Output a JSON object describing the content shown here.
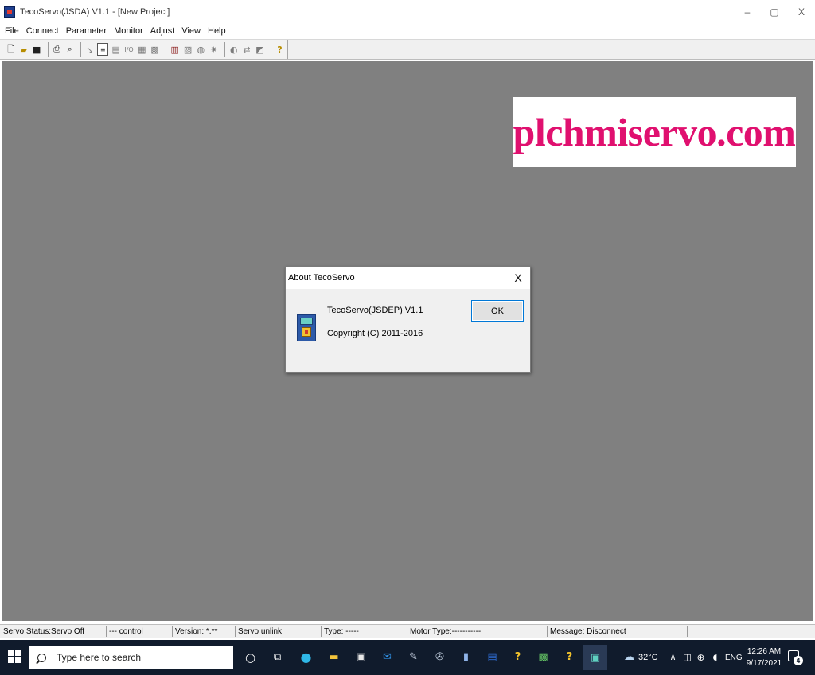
{
  "window": {
    "title": "TecoServo(JSDA) V1.1 - [New Project]",
    "controls": {
      "minimize": "–",
      "restore": "▢",
      "close": "X"
    }
  },
  "menu": [
    "File",
    "Connect",
    "Parameter",
    "Monitor",
    "Adjust",
    "View",
    "Help"
  ],
  "toolbar": {
    "icons": [
      "new-file-icon",
      "open-folder-icon",
      "save-icon",
      "print-icon",
      "print-preview-icon",
      "read-icon",
      "document-icon",
      "parameter-table-icon",
      "io-icon",
      "grid-icon",
      "grid-alt-icon",
      "alarm-icon",
      "monitor-icon",
      "scope-icon",
      "gear-icon",
      "tune-icon",
      "jog-icon",
      "calibrate-icon",
      "help-icon"
    ],
    "io_label": "I/O"
  },
  "watermark": {
    "text": "plchmiservo.com",
    "color": "#e0106f"
  },
  "dialog": {
    "title": "About TecoServo",
    "close": "X",
    "product": "TecoServo(JSDEP) V1.1",
    "copyright": "Copyright (C) 2011-2016",
    "ok_label": "OK"
  },
  "statusbar": {
    "servo_status": "Servo Status:Servo Off",
    "control": "--- control",
    "version": "Version: *.**",
    "link": "Servo unlink",
    "type": "Type: -----",
    "motor_type": "Motor Type:-----------",
    "message": "Message: Disconnect"
  },
  "taskbar": {
    "search_placeholder": "Type here to search",
    "apps": [
      "cortana-icon",
      "task-view-icon",
      "edge-icon",
      "file-explorer-icon",
      "store-icon",
      "mail-icon",
      "paint-icon",
      "tool-icon",
      "notepad-icon",
      "word-icon",
      "help-app-icon",
      "app-green-icon",
      "help-app-2-icon",
      "tecoservo-icon"
    ],
    "weather": "32°C",
    "language": "ENG",
    "time": "12:26 AM",
    "date": "9/17/2021",
    "notification_count": "4"
  }
}
